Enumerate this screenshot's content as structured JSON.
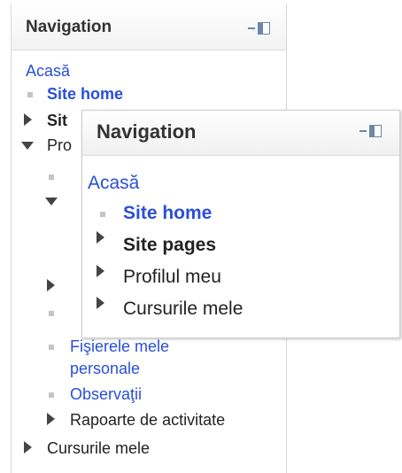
{
  "back_block": {
    "title": "Navigation",
    "home": "Acasă",
    "site_home": "Site home",
    "site_pages": "Sit",
    "profile": "Pro",
    "files": "Fişierele mele",
    "files_2": "personale",
    "notes": "Observaţii",
    "reports": "Rapoarte de activitate",
    "my_courses": "Cursurile mele"
  },
  "front_block": {
    "title": "Navigation",
    "home": "Acasă",
    "site_home": "Site home",
    "site_pages": "Site pages",
    "profile": "Profilul meu",
    "my_courses": "Cursurile mele"
  },
  "colors": {
    "link": "#2a4fd6",
    "text": "#222222",
    "header_bg": "#f2f2f2",
    "dock_icon": "#6d87a8"
  },
  "icons": {
    "dock": "dock-block-icon",
    "collapsed": "triangle-right-icon",
    "expanded": "triangle-down-icon",
    "leaf": "square-bullet-icon"
  }
}
